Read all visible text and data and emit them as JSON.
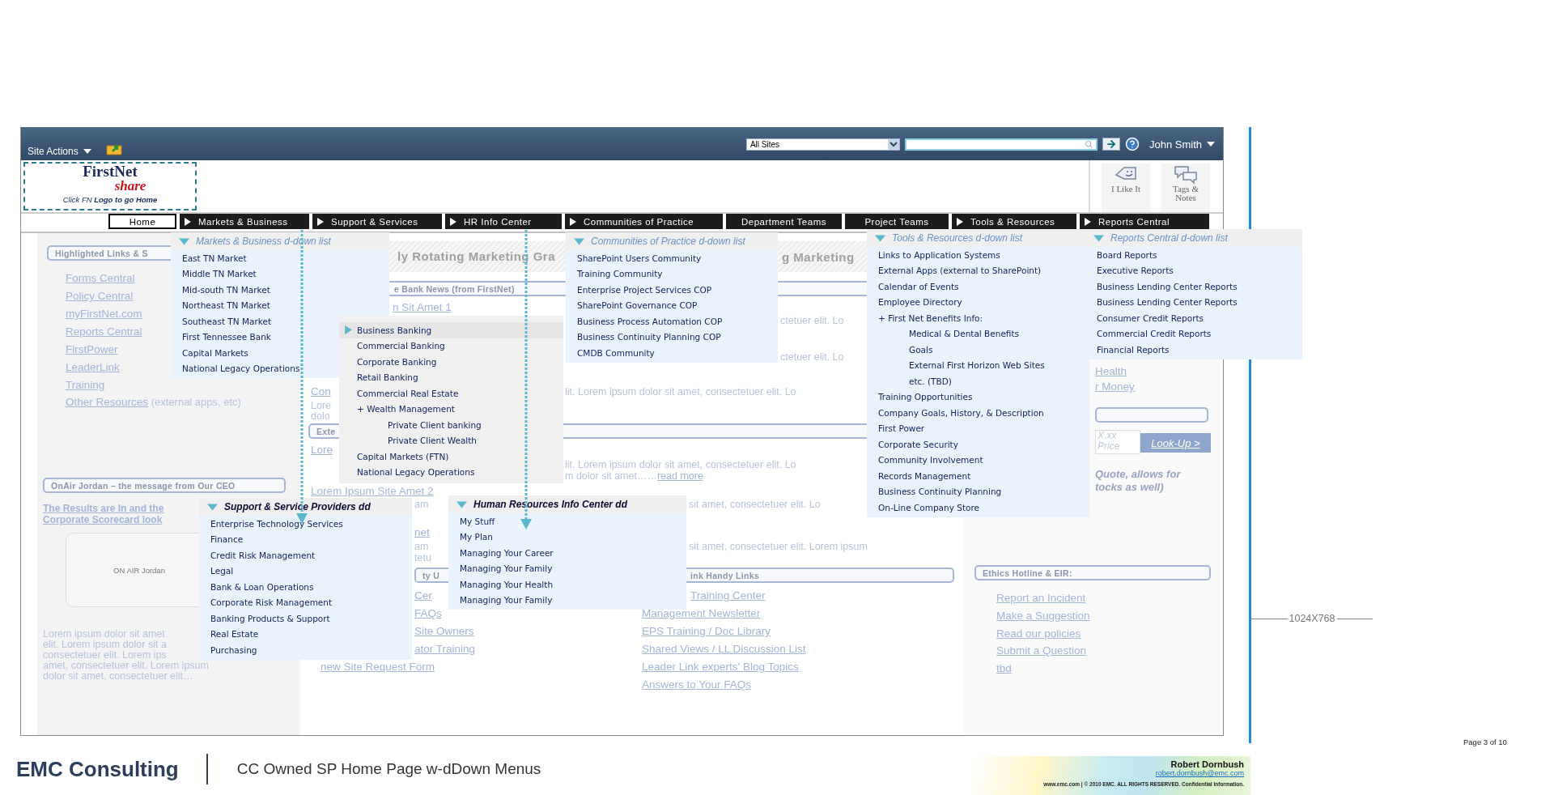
{
  "top_bar": {
    "site_actions": "Site Actions",
    "scope_select": "All Sites",
    "user": "John Smith"
  },
  "logo": {
    "name": "FirstNet",
    "tagline": "share",
    "hint": "Click FN **Logo to go Home**"
  },
  "social": [
    {
      "label": "I Like It",
      "kind": "like"
    },
    {
      "label": "Tags & Notes",
      "kind": "tags"
    }
  ],
  "nav": [
    {
      "label": "Home",
      "selected": true,
      "has_menu": false
    },
    {
      "label": "Markets & Business",
      "selected": false,
      "has_menu": true
    },
    {
      "label": "Support & Services",
      "selected": false,
      "has_menu": true
    },
    {
      "label": "HR Info Center",
      "selected": false,
      "has_menu": true
    },
    {
      "label": "Communities of Practice",
      "selected": false,
      "has_menu": true
    },
    {
      "label": "Department Teams",
      "selected": false,
      "has_menu": false
    },
    {
      "label": "Project Teams",
      "selected": false,
      "has_menu": false
    },
    {
      "label": "Tools & Resources",
      "selected": false,
      "has_menu": true
    },
    {
      "label": "Reports Central",
      "selected": false,
      "has_menu": true
    }
  ],
  "left_column": [
    {
      "kind": "header",
      "text": "Highlighted Links & S"
    },
    {
      "kind": "link",
      "text": "Forms Central"
    },
    {
      "kind": "link",
      "text": "Policy Central"
    },
    {
      "kind": "link",
      "text": "myFirstNet.com"
    },
    {
      "kind": "link",
      "text": "Reports Central"
    },
    {
      "kind": "link",
      "text": "FirstPower"
    },
    {
      "kind": "link",
      "text": "LeaderLink"
    },
    {
      "kind": "link",
      "text": "Training"
    },
    {
      "kind": "note",
      "link": "Other Resources",
      "text": "(external apps, etc)"
    },
    {
      "kind": "header",
      "text": "OnAir Jordan – the message from Our CEO"
    },
    {
      "kind": "boldlink",
      "text": "The Results are In and the"
    },
    {
      "kind": "boldlink",
      "text": "Corporate Scorecard look"
    },
    {
      "kind": "video",
      "text": "ON AIR Jordan"
    },
    {
      "kind": "text",
      "text": "Lorem ipsum dolor sit amet"
    },
    {
      "kind": "text",
      "text": "elit. Lorem ipsum dolor sit a"
    },
    {
      "kind": "text",
      "text": "consectetuer elit. Lorem ips"
    },
    {
      "kind": "text",
      "text": "amet, consectetuer elit. Lorem ipsum"
    },
    {
      "kind": "text",
      "text": "dolor sit amet, consectetuer elit…"
    }
  ],
  "center_column": [
    {
      "kind": "banner",
      "texts": [
        "ly Rotating Marketing Gra",
        "g Marketing"
      ]
    },
    {
      "kind": "header",
      "text": "e Bank News (from FirstNet)"
    },
    {
      "kind": "link",
      "text": "n Sit Amet 1"
    },
    {
      "kind": "text",
      "text": "ctetuer elit. Lo"
    },
    {
      "kind": "text",
      "text": "ctetuer elit. Lo"
    },
    {
      "kind": "link",
      "text": "Con"
    },
    {
      "kind": "text",
      "text": "lit. Lorem ipsum dolor sit amet, consectetuer elit. Lo"
    },
    {
      "kind": "text",
      "text": "Lore"
    },
    {
      "kind": "text",
      "text": "dolo"
    },
    {
      "kind": "header",
      "text": "Exte"
    },
    {
      "kind": "link",
      "text": "Lore"
    },
    {
      "kind": "text",
      "text": "lit. Lorem ipsum dolor sit amet, consectetuer elit. Lo"
    },
    {
      "kind": "note_text",
      "text": "m dolor sit amet……",
      "link": "read more"
    },
    {
      "kind": "link",
      "text": "Lorem Ipsum Site Amet 2"
    },
    {
      "kind": "text",
      "text": "am"
    },
    {
      "kind": "text",
      "text": "sit amet, consectetuer elit. Lo"
    },
    {
      "kind": "link",
      "text": "net"
    },
    {
      "kind": "text",
      "text": "am"
    },
    {
      "kind": "text",
      "text": "sit amet, consectetuer elit. Lorem ipsum"
    },
    {
      "kind": "text",
      "text": "tetu"
    },
    {
      "kind": "header",
      "text": "ty U"
    },
    {
      "kind": "header",
      "text": "ink Handy Links"
    },
    {
      "kind": "link",
      "text": "Cer"
    },
    {
      "kind": "link",
      "text": "Training Center"
    },
    {
      "kind": "link",
      "text": "FAQs"
    },
    {
      "kind": "link",
      "text": "Management Newsletter"
    },
    {
      "kind": "link",
      "text": "Site Owners"
    },
    {
      "kind": "link",
      "text": "EPS Training / Doc Library"
    },
    {
      "kind": "link",
      "text": "ator Training"
    },
    {
      "kind": "link",
      "text": "Shared Views / LL Discussion List"
    },
    {
      "kind": "link",
      "text": "new Site Request Form"
    },
    {
      "kind": "link",
      "text": "Leader Link experts' Blog Topics"
    },
    {
      "kind": "link",
      "text": "Answers to Your FAQs"
    }
  ],
  "right_column": [
    {
      "kind": "link",
      "text": "Health"
    },
    {
      "kind": "link",
      "text": "r Money"
    },
    {
      "kind": "blank_header"
    },
    {
      "kind": "field",
      "placeholder": "X.xx Price"
    },
    {
      "kind": "button",
      "text": "Look-Up >"
    },
    {
      "kind": "italic",
      "text": "Quote, allows for"
    },
    {
      "kind": "italic",
      "text": "tocks as well)"
    },
    {
      "kind": "header",
      "text": "Ethics Hotline & EIR:"
    },
    {
      "kind": "link",
      "text": "Report an Incident"
    },
    {
      "kind": "link",
      "text": "Make a Suggestion"
    },
    {
      "kind": "link",
      "text": "Read our policies"
    },
    {
      "kind": "link",
      "text": "Submit a Question"
    },
    {
      "kind": "link",
      "text": "tbd"
    }
  ],
  "dropdowns": [
    {
      "header": "Markets & Business d-down list",
      "emphasis": false,
      "items": [
        {
          "label": "East TN Market"
        },
        {
          "label": "Middle TN Market"
        },
        {
          "label": "Mid-south TN Market"
        },
        {
          "label": "Northeast TN Market"
        },
        {
          "label": "Southeast TN Market"
        },
        {
          "label": "First Tennessee Bank"
        },
        {
          "label": "Capital Markets"
        },
        {
          "label": "National Legacy Operations"
        }
      ]
    },
    {
      "items": [
        {
          "label": "Business Banking",
          "selected": true
        },
        {
          "label": "Commercial Banking",
          "selected": false
        },
        {
          "label": "Corporate Banking",
          "selected": false
        },
        {
          "label": "Retail Banking",
          "selected": false
        },
        {
          "label": "Commercial Real Estate",
          "selected": false
        },
        {
          "label": "+ Wealth Management",
          "selected": false,
          "children": [
            {
              "label": "Private Client banking",
              "selected": false
            },
            {
              "label": "Private Client Wealth",
              "selected": false
            }
          ]
        },
        {
          "label": "Capital Markets (FTN)",
          "selected": false
        },
        {
          "label": "National Legacy Operations",
          "selected": false
        }
      ]
    },
    {
      "header": "Communities of Practice d-down list",
      "emphasis": false,
      "items": [
        {
          "label": "SharePoint Users Community"
        },
        {
          "label": "Training Community"
        },
        {
          "label": "Enterprise Project Services COP"
        },
        {
          "label": "SharePoint Governance COP"
        },
        {
          "label": "Business Process Automation COP"
        },
        {
          "label": "Business Continuity Planning COP"
        },
        {
          "label": "CMDB Community"
        }
      ]
    },
    {
      "header": "Tools & Resources d-down list",
      "emphasis": false,
      "items": [
        {
          "label": "Links to Application Systems"
        },
        {
          "label": "External Apps (external to SharePoint)"
        },
        {
          "label": "Calendar of Events"
        },
        {
          "label": "Employee Directory"
        },
        {
          "label": "+ First Net Benefits Info:",
          "children": [
            {
              "label": "Medical & Dental Benefits"
            },
            {
              "label": "Goals"
            },
            {
              "label": "External First Horizon Web Sites"
            },
            {
              "label": "etc. (TBD)"
            }
          ]
        },
        {
          "label": "Training Opportunities"
        },
        {
          "label": "Company Goals, History, & Description"
        },
        {
          "label": "First Power"
        },
        {
          "label": "Corporate Security"
        },
        {
          "label": "Community Involvement"
        },
        {
          "label": "Records Management"
        },
        {
          "label": "Business Continuity Planning"
        },
        {
          "label": "On-Line Company Store"
        }
      ]
    },
    {
      "header": "Reports Central d-down list",
      "emphasis": false,
      "items": [
        {
          "label": "Board Reports"
        },
        {
          "label": "Executive Reports"
        },
        {
          "label": "Business Lending Center Reports"
        },
        {
          "label": "Business Lending Center Reports"
        },
        {
          "label": "Consumer Credit Reports"
        },
        {
          "label": "Commercial Credit Reports"
        },
        {
          "label": "Financial Reports"
        }
      ]
    },
    {
      "header": "Support & Service Providers dd",
      "emphasis": true,
      "items": [
        {
          "label": "Enterprise Technology Services"
        },
        {
          "label": "Finance"
        },
        {
          "label": "Credit Risk Management"
        },
        {
          "label": "Legal"
        },
        {
          "label": "Bank & Loan Operations"
        },
        {
          "label": "Corporate Risk Management"
        },
        {
          "label": "Banking Products & Support"
        },
        {
          "label": "Real Estate"
        },
        {
          "label": "Purchasing"
        }
      ]
    },
    {
      "header": "Human  Resources Info Center dd",
      "emphasis": true,
      "items": [
        {
          "label": "My Stuff"
        },
        {
          "label": "My Plan"
        },
        {
          "label": "Managing Your Career"
        },
        {
          "label": "Managing Your Family"
        },
        {
          "label": "Managing Your Health"
        },
        {
          "label": "Managing Your Family"
        }
      ]
    }
  ],
  "annotation": {
    "dimension": "1024X768",
    "page": "Page 3 of 10"
  },
  "footer": {
    "brand": "EMC Consulting",
    "title": "CC Owned SP Home Page w-dDown Menus",
    "author": "Robert Dornbush",
    "email": "robert.dornbush@emc.com",
    "legal": "www.emc.com  |  © 2010 EMC. ALL RIGHTS RESERVED. Confidential Information."
  }
}
